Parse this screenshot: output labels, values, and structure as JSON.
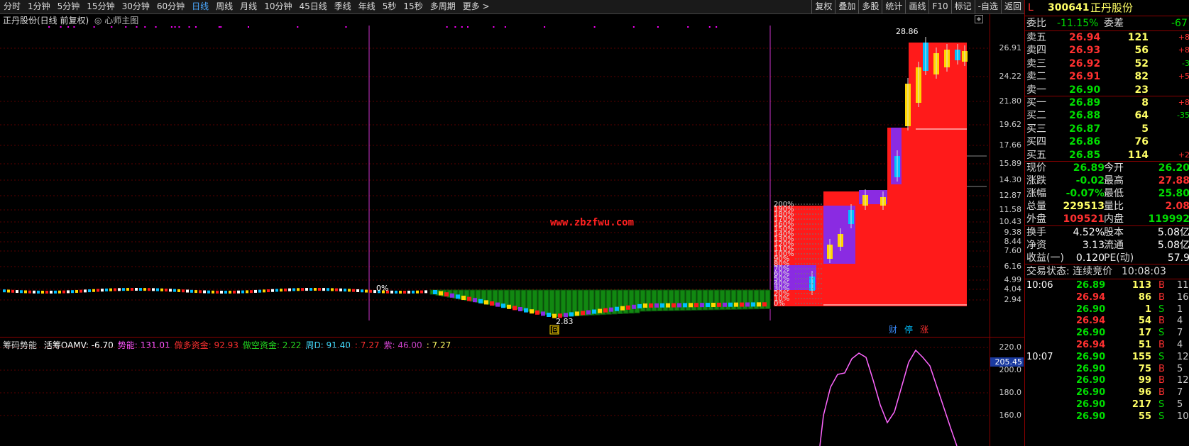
{
  "toolbar": {
    "periods": [
      "分时",
      "1分钟",
      "5分钟",
      "15分钟",
      "30分钟",
      "60分钟",
      "日线",
      "周线",
      "月线",
      "10分钟",
      "45日线",
      "季线",
      "年线",
      "5秒",
      "15秒",
      "多周期",
      "更多 >"
    ],
    "active_period": "日线",
    "right_buttons": [
      "复权",
      "叠加",
      "多股",
      "统计",
      "画线",
      "F10",
      "标记",
      "-自选",
      "返回"
    ]
  },
  "chart": {
    "title": "正丹股份(日线 前复权)",
    "subtitle": "◎ 心师主图",
    "price_ticks": [
      "26.91",
      "24.22",
      "21.80",
      "19.62",
      "17.66",
      "15.89",
      "14.30",
      "12.87",
      "11.58",
      "10.43",
      "9.38",
      "8.44",
      "7.60",
      "6.16",
      "4.99",
      "4.04",
      "2.94"
    ],
    "high_label": "28.86",
    "low_label": "2.83",
    "zero_label": "0%",
    "pct_labels": [
      "200%",
      "190%",
      "180%",
      "170%",
      "160%",
      "150%",
      "140%",
      "130%",
      "120%",
      "110%",
      "100%",
      "90%",
      "80%",
      "70%",
      "60%",
      "50%",
      "40%",
      "30%",
      "20%",
      "10%",
      "0%"
    ],
    "watermark": "www.zbzfwu.com",
    "tags": [
      "财",
      "停",
      "涨"
    ],
    "box_tag": "回",
    "colors": {
      "up": "#ff1a1a",
      "purple": "#8a2be2",
      "green": "#118811",
      "yellow": "#ffd700",
      "cyan": "#00bfff",
      "magenta": "#ff00ff"
    }
  },
  "indicator": {
    "name": "筹码势能",
    "items": [
      {
        "label": "活筹OAMV: -6.70",
        "color": "#ffffff"
      },
      {
        "label": "势能: 131.01",
        "color": "#ff55ff"
      },
      {
        "label": "做多资金: 92.93",
        "color": "#ff3030"
      },
      {
        "label": "做空资金: 2.22",
        "color": "#22dd22"
      },
      {
        "label": "周D: 91.40",
        "color": "#44ddff"
      },
      {
        "label": ": 7.27",
        "color": "#ff3030"
      },
      {
        "label": "紫: 46.00",
        "color": "#cc44cc"
      },
      {
        "label": ": 7.27",
        "color": "#ffff66"
      }
    ],
    "ticks": [
      "220.0",
      "200.0",
      "180.0",
      "160.0"
    ],
    "current_value": "205.45"
  },
  "quote": {
    "code": "300641",
    "name": "正丹股份",
    "flag": "L",
    "webi_label": "委比",
    "webi_value": "-11.15%",
    "weicha_label": "委差",
    "weicha_value": "-67",
    "sells": [
      {
        "label": "卖五",
        "price": "26.94",
        "vol": "121",
        "chg": "+8"
      },
      {
        "label": "卖四",
        "price": "26.93",
        "vol": "56",
        "chg": "+8"
      },
      {
        "label": "卖三",
        "price": "26.92",
        "vol": "52",
        "chg": "-3"
      },
      {
        "label": "卖二",
        "price": "26.91",
        "vol": "82",
        "chg": "+5"
      },
      {
        "label": "卖一",
        "price": "26.90",
        "vol": "23",
        "chg": ""
      }
    ],
    "buys": [
      {
        "label": "买一",
        "price": "26.89",
        "vol": "8",
        "chg": "+8"
      },
      {
        "label": "买二",
        "price": "26.88",
        "vol": "64",
        "chg": "-35"
      },
      {
        "label": "买三",
        "price": "26.87",
        "vol": "5",
        "chg": ""
      },
      {
        "label": "买四",
        "price": "26.86",
        "vol": "76",
        "chg": ""
      },
      {
        "label": "买五",
        "price": "26.85",
        "vol": "114",
        "chg": "+2"
      }
    ],
    "stats": [
      {
        "l1": "现价",
        "v1": "26.89",
        "l2": "今开",
        "v2": "26.20",
        "c1": "#00dd00",
        "c2": "#00dd00"
      },
      {
        "l1": "涨跌",
        "v1": "-0.02",
        "l2": "最高",
        "v2": "27.88",
        "c1": "#00dd00",
        "c2": "#ff3030"
      },
      {
        "l1": "涨幅",
        "v1": "-0.07%",
        "l2": "最低",
        "v2": "25.80",
        "c1": "#00dd00",
        "c2": "#00dd00"
      },
      {
        "l1": "总量",
        "v1": "229513",
        "l2": "量比",
        "v2": "2.08",
        "c1": "#ffff66",
        "c2": "#ff3030"
      },
      {
        "l1": "外盘",
        "v1": "109521",
        "l2": "内盘",
        "v2": "119992",
        "c1": "#ff3030",
        "c2": "#00dd00"
      }
    ],
    "stats2": [
      {
        "l1": "换手",
        "v1": "4.52%",
        "l2": "股本",
        "v2": "5.08亿"
      },
      {
        "l1": "净资",
        "v1": "3.13",
        "l2": "流通",
        "v2": "5.08亿"
      },
      {
        "l1": "收益(一)",
        "v1": "0.120",
        "l2": "PE(动)",
        "v2": "57.9"
      }
    ],
    "status_label": "交易状态: 连续竞价",
    "status_time": "10:08:03",
    "ticks": [
      {
        "time": "10:06",
        "price": "26.89",
        "vol": "113",
        "side": "B",
        "n": "11",
        "pc": "#00dd00"
      },
      {
        "time": "",
        "price": "26.94",
        "vol": "86",
        "side": "B",
        "n": "16",
        "pc": "#ff3030"
      },
      {
        "time": "",
        "price": "26.90",
        "vol": "1",
        "side": "S",
        "n": "1",
        "pc": "#00dd00"
      },
      {
        "time": "",
        "price": "26.94",
        "vol": "54",
        "side": "B",
        "n": "4",
        "pc": "#ff3030"
      },
      {
        "time": "",
        "price": "26.90",
        "vol": "17",
        "side": "S",
        "n": "7",
        "pc": "#00dd00"
      },
      {
        "time": "",
        "price": "26.94",
        "vol": "51",
        "side": "B",
        "n": "4",
        "pc": "#ff3030"
      },
      {
        "time": "10:07",
        "price": "26.90",
        "vol": "155",
        "side": "S",
        "n": "12",
        "pc": "#00dd00"
      },
      {
        "time": "",
        "price": "26.90",
        "vol": "75",
        "side": "B",
        "n": "5",
        "pc": "#00dd00"
      },
      {
        "time": "",
        "price": "26.90",
        "vol": "99",
        "side": "B",
        "n": "12",
        "pc": "#00dd00"
      },
      {
        "time": "",
        "price": "26.90",
        "vol": "96",
        "side": "B",
        "n": "7",
        "pc": "#00dd00"
      },
      {
        "time": "",
        "price": "26.90",
        "vol": "217",
        "side": "S",
        "n": "5",
        "pc": "#00dd00"
      },
      {
        "time": "",
        "price": "26.90",
        "vol": "55",
        "side": "S",
        "n": "10",
        "pc": "#00dd00"
      }
    ]
  }
}
